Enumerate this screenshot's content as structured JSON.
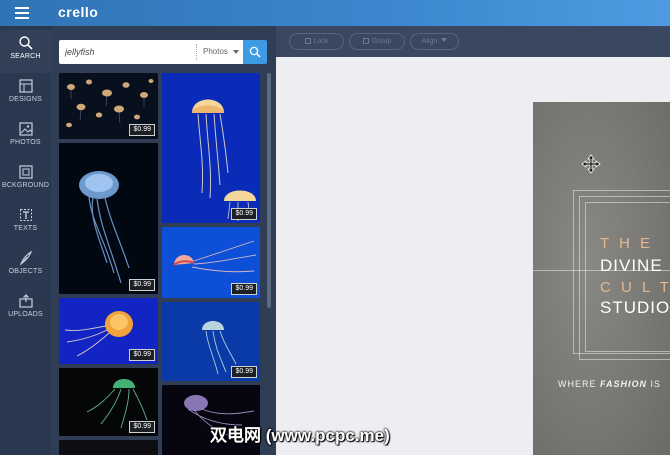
{
  "app": {
    "logo": "crello"
  },
  "sidebar": {
    "items": [
      {
        "label": "SEARCH",
        "icon": "search-icon",
        "active": true
      },
      {
        "label": "DESIGNS",
        "icon": "designs-icon"
      },
      {
        "label": "PHOTOS",
        "icon": "photos-icon"
      },
      {
        "label": "BCKGROUND",
        "icon": "background-icon"
      },
      {
        "label": "TEXTS",
        "icon": "texts-icon"
      },
      {
        "label": "OBJECTS",
        "icon": "objects-icon"
      },
      {
        "label": "UPLOADS",
        "icon": "uploads-icon"
      }
    ]
  },
  "search": {
    "value": "jellyfish",
    "filter": "Photos"
  },
  "results": {
    "price": "$0.99",
    "tiles": [
      {
        "name": "jellyfish-school-photo"
      },
      {
        "name": "single-blue-jellyfish-photo"
      },
      {
        "name": "jellyfish-pair-photo"
      },
      {
        "name": "red-jellyfish-blue-photo"
      },
      {
        "name": "orange-jellyfish-photo"
      },
      {
        "name": "pale-jellyfish-photo"
      },
      {
        "name": "green-jellyfish-photo"
      },
      {
        "name": "purple-jellyfish-photo"
      }
    ]
  },
  "toolbar": {
    "lock": "Lock",
    "group": "Group",
    "align": "Align"
  },
  "design": {
    "line1": "T H E",
    "line2": "DIVINE",
    "line3": "C U L T",
    "line4": "STUDIO",
    "tagline_pre": "WHERE",
    "tagline_bold": "FASHION",
    "tagline_post": "IS"
  },
  "watermark": "双电网 (www.pcpc.me)",
  "colors": {
    "accent": "#3d9be4",
    "sidebar": "#2b3950",
    "panel": "#2f3d55",
    "toolbar": "#3a4760"
  }
}
